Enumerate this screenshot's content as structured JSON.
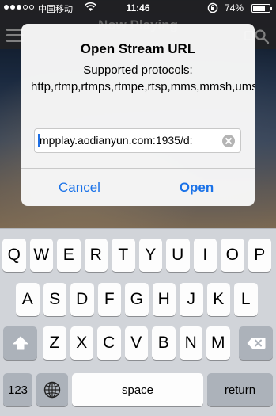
{
  "status_bar": {
    "carrier": "中国移动",
    "time": "11:46",
    "battery_percent_text": "74%",
    "battery_level": 0.74
  },
  "app": {
    "title": "Now Playing"
  },
  "dialog": {
    "title": "Open Stream URL",
    "message": "Supported protocols: http,rtmp,rtmps,rtmpe,rtsp,mms,mmsh,ums",
    "input_value": ":mpplay.aodianyun.com:1935/d",
    "cancel_label": "Cancel",
    "open_label": "Open"
  },
  "keyboard": {
    "row1": [
      "Q",
      "W",
      "E",
      "R",
      "T",
      "Y",
      "U",
      "I",
      "O",
      "P"
    ],
    "row2": [
      "A",
      "S",
      "D",
      "F",
      "G",
      "H",
      "J",
      "K",
      "L"
    ],
    "row3": [
      "Z",
      "X",
      "C",
      "V",
      "B",
      "N",
      "M"
    ],
    "numbers_label": "123",
    "space_label": "space",
    "return_label": "return"
  },
  "icons": {
    "shift": "shift-icon",
    "backspace": "backspace-icon",
    "globe": "globe-icon",
    "menu": "hamburger-icon",
    "search": "search-icon",
    "clear": "clear-icon"
  },
  "colors": {
    "accent": "#1a72e8",
    "keyboard_bg": "#d1d4d9",
    "key_bg": "#fdfdfd",
    "key_dark_bg": "#acb2ba"
  }
}
